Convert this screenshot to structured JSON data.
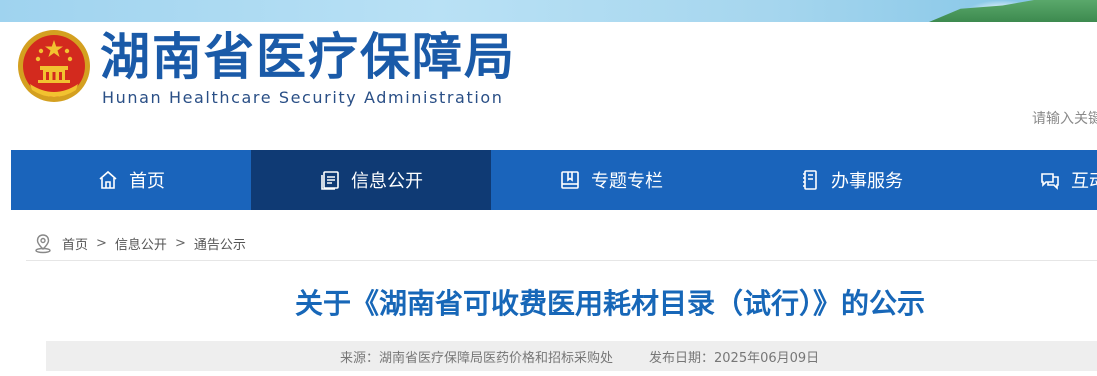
{
  "header": {
    "title": "湖南省医疗保障局",
    "subtitle": "Hunan Healthcare Security Administration",
    "search_placeholder": "请输入关键字"
  },
  "nav": {
    "items": [
      {
        "label": "首页",
        "icon": "home-icon"
      },
      {
        "label": "信息公开",
        "icon": "document-list-icon",
        "active": true
      },
      {
        "label": "专题专栏",
        "icon": "book-icon"
      },
      {
        "label": "办事服务",
        "icon": "service-guide-icon"
      },
      {
        "label": "互动交流",
        "icon": "chat-icon"
      }
    ]
  },
  "breadcrumb": {
    "home": "首页",
    "sep": ">",
    "section": "信息公开",
    "current": "通告公示"
  },
  "article": {
    "title": "关于《湖南省可收费医用耗材目录（试行）》的公示",
    "source": "来源：湖南省医疗保障局医药价格和招标采购处",
    "date": "发布日期：2025年06月09日"
  },
  "colors": {
    "nav_bg": "#1a64bb",
    "nav_active_bg": "#0f3a74",
    "title_blue": "#1767b8",
    "brand_blue": "#1a5aa8"
  }
}
